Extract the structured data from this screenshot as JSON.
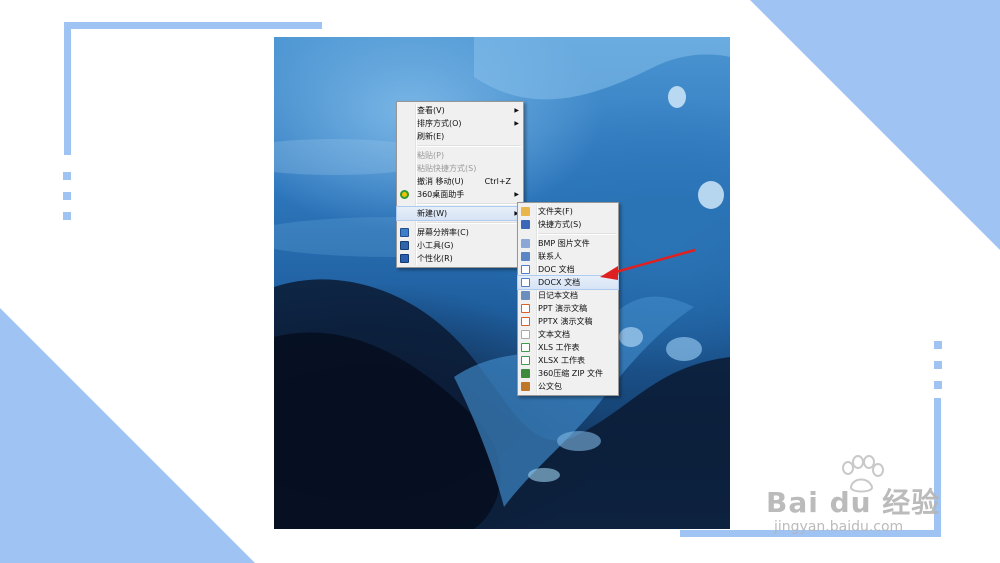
{
  "context_menu": {
    "items": [
      {
        "label": "查看(V)",
        "submenu": true
      },
      {
        "label": "排序方式(O)",
        "submenu": true
      },
      {
        "label": "刷新(E)"
      },
      {
        "separator": true
      },
      {
        "label": "粘贴(P)",
        "disabled": true
      },
      {
        "label": "粘贴快捷方式(S)",
        "disabled": true
      },
      {
        "label": "撤消 移动(U)",
        "shortcut": "Ctrl+Z"
      },
      {
        "label": "360桌面助手",
        "submenu": true,
        "icon": "360-icon"
      },
      {
        "separator": true
      },
      {
        "label": "新建(W)",
        "submenu": true,
        "highlighted": true
      },
      {
        "separator": true
      },
      {
        "label": "屏幕分辨率(C)",
        "icon": "display-icon"
      },
      {
        "label": "小工具(G)",
        "icon": "gadget-icon"
      },
      {
        "label": "个性化(R)",
        "icon": "personalize-icon"
      }
    ]
  },
  "new_submenu": {
    "items": [
      {
        "label": "文件夹(F)",
        "icon": "folder-icon",
        "color": "#e8b64a"
      },
      {
        "label": "快捷方式(S)",
        "icon": "shortcut-icon",
        "color": "#3a67b8"
      },
      {
        "separator": true
      },
      {
        "label": "BMP 图片文件",
        "icon": "bmp-icon",
        "color": "#8aa7d6"
      },
      {
        "label": "联系人",
        "icon": "contact-icon",
        "color": "#5a86c6"
      },
      {
        "label": "DOC 文档",
        "icon": "doc-icon",
        "color": "#4f7fc9"
      },
      {
        "label": "DOCX 文档",
        "icon": "docx-icon",
        "color": "#4f7fc9",
        "highlighted": true
      },
      {
        "label": "日记本文档",
        "icon": "journal-icon",
        "color": "#6a8fbf"
      },
      {
        "label": "PPT 演示文稿",
        "icon": "ppt-icon",
        "color": "#d9602b"
      },
      {
        "label": "PPTX 演示文稿",
        "icon": "pptx-icon",
        "color": "#d9602b"
      },
      {
        "label": "文本文档",
        "icon": "txt-icon",
        "color": "#cfcfcf"
      },
      {
        "label": "XLS 工作表",
        "icon": "xls-icon",
        "color": "#3d9a4a"
      },
      {
        "label": "XLSX 工作表",
        "icon": "xlsx-icon",
        "color": "#3d9a4a"
      },
      {
        "label": "360压缩 ZIP 文件",
        "icon": "zip-icon",
        "color": "#3f8b3c"
      },
      {
        "label": "公文包",
        "icon": "briefcase-icon",
        "color": "#c0772a"
      }
    ]
  },
  "watermark": {
    "logo_text": "Bai du 经验",
    "url": "jingyan.baidu.com"
  },
  "colors": {
    "deco_blue": "#9fc4f3",
    "annotation_arrow": "#e02020"
  }
}
